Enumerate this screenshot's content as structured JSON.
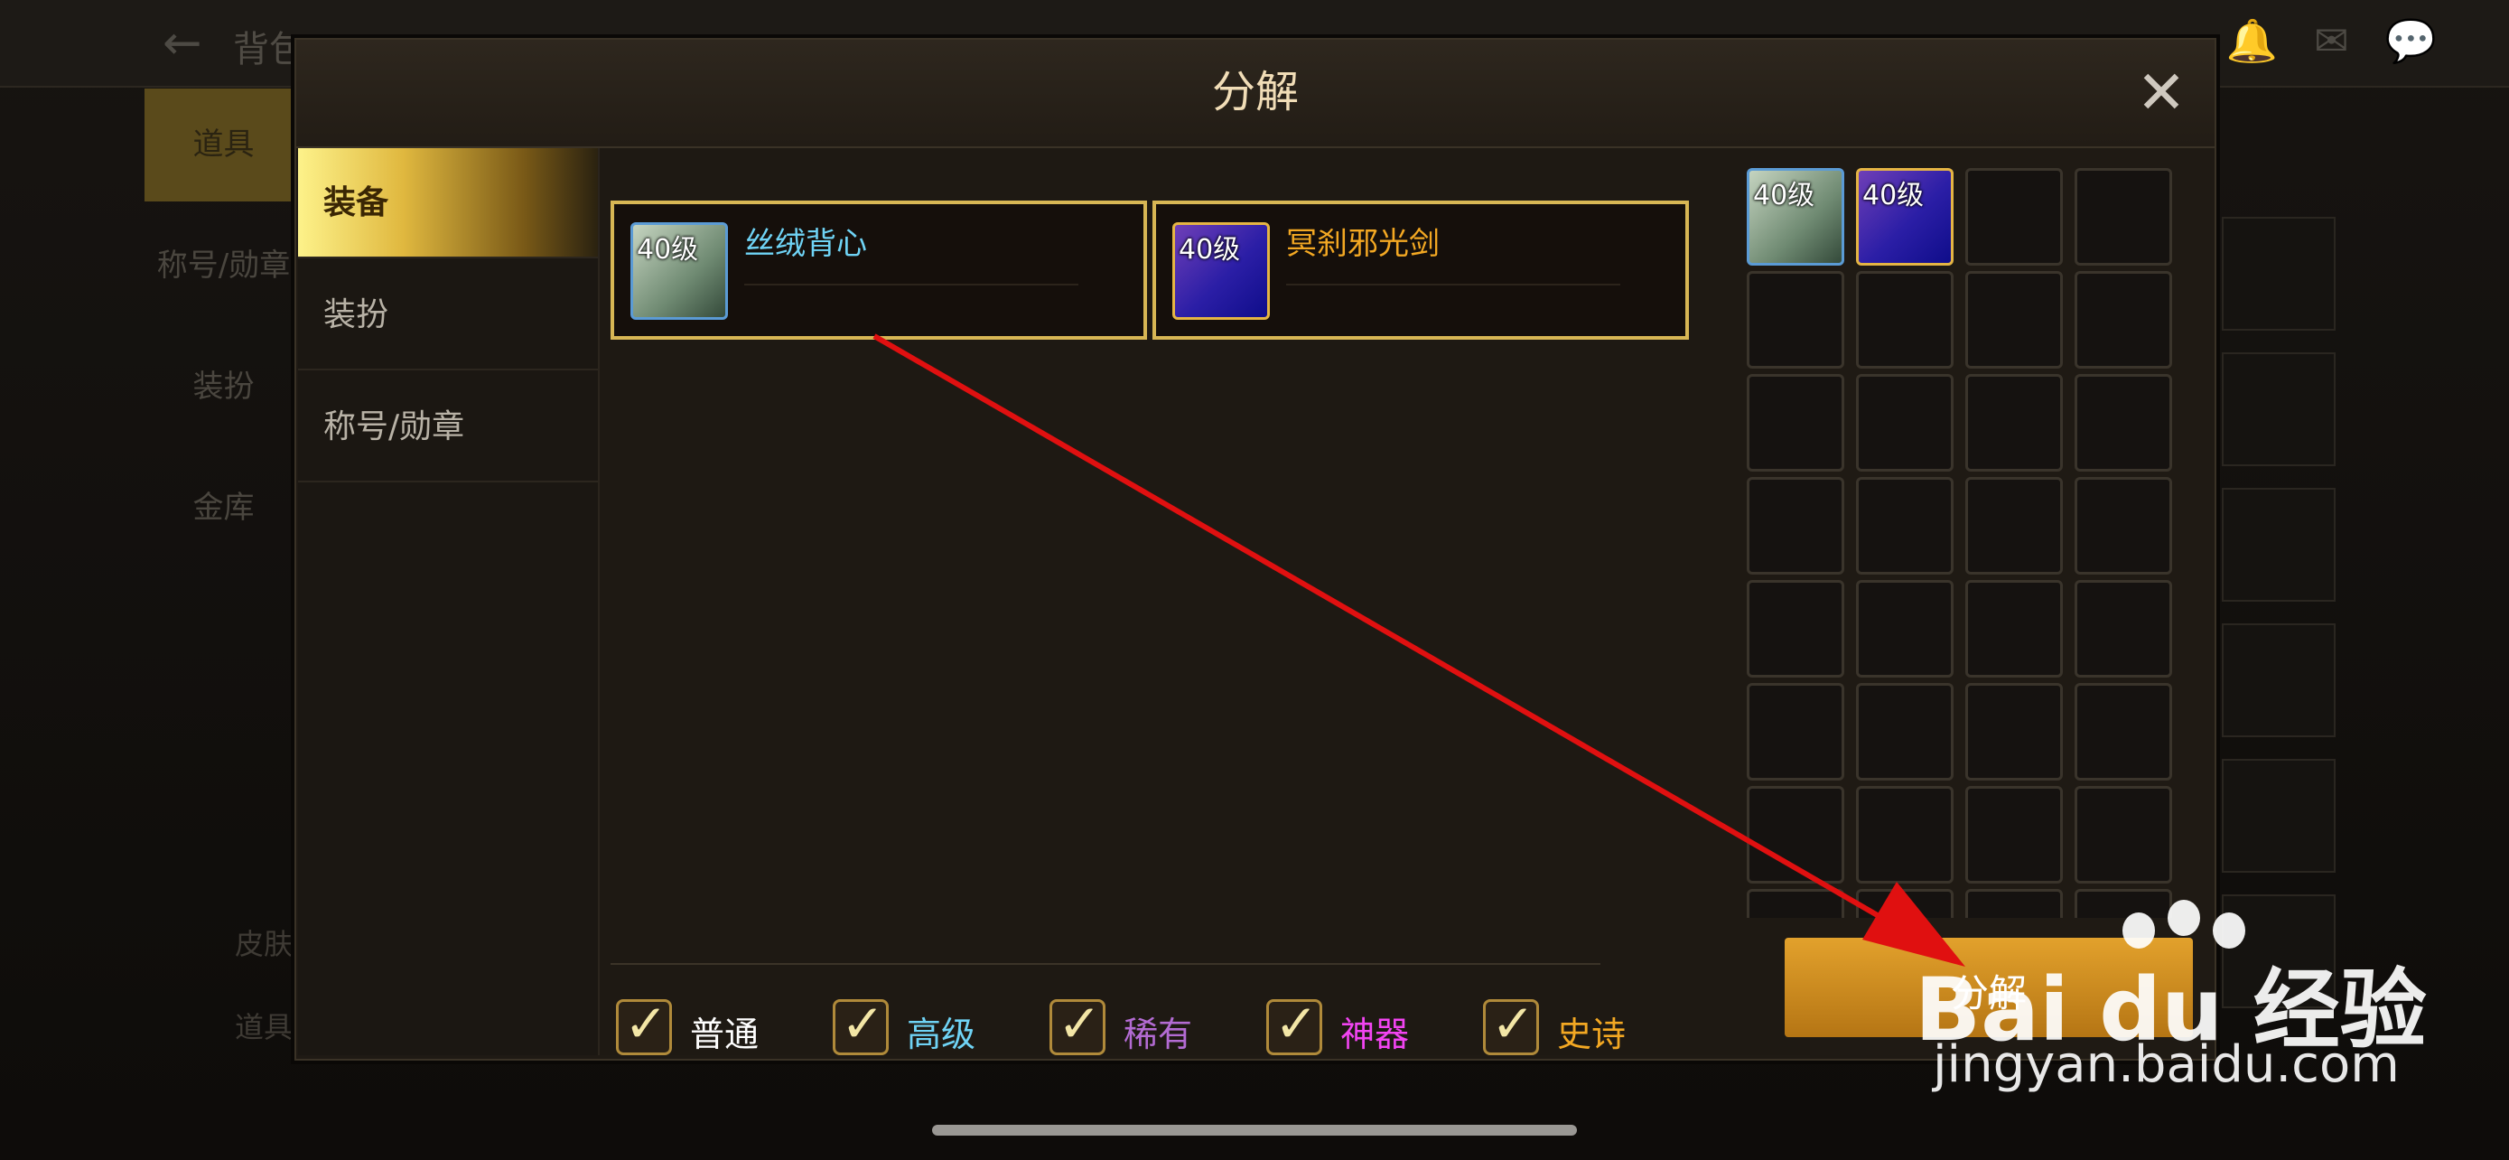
{
  "background": {
    "back_icon": "←",
    "title": "背包",
    "tabs": [
      "道具",
      "称号/勋章",
      "装扮",
      "金库"
    ],
    "bottom_left": [
      "皮肤",
      "道具"
    ]
  },
  "dialog": {
    "title": "分解",
    "close_icon": "✕",
    "sidebar": [
      {
        "label": "装备",
        "active": true
      },
      {
        "label": "装扮",
        "active": false
      },
      {
        "label": "称号/勋章",
        "active": false
      }
    ],
    "selected_items": [
      {
        "level": "40级",
        "name": "丝绒背心",
        "name_color": "#6fd3f5",
        "icon": "vest-icon",
        "border_color": "#5b9bd5"
      },
      {
        "level": "40级",
        "name": "冥刹邪光剑",
        "name_color": "#f3a823",
        "icon": "sword-icon",
        "border_color": "#e5b544"
      }
    ],
    "grid_items": [
      {
        "level": "40级",
        "icon": "vest-icon"
      },
      {
        "level": "40级",
        "icon": "sword-icon"
      }
    ],
    "filters": [
      {
        "label": "普通",
        "color": "#ffffff",
        "checked": true
      },
      {
        "label": "高级",
        "color": "#6fd3f5",
        "checked": true
      },
      {
        "label": "稀有",
        "color": "#b36bd3",
        "checked": true
      },
      {
        "label": "神器",
        "color": "#f244f2",
        "checked": true
      },
      {
        "label": "史诗",
        "color": "#f3a823",
        "checked": true
      }
    ],
    "decompose_button": "分解"
  },
  "watermark": {
    "logo": "Bai du 经验",
    "url": "jingyan.baidu.com"
  }
}
